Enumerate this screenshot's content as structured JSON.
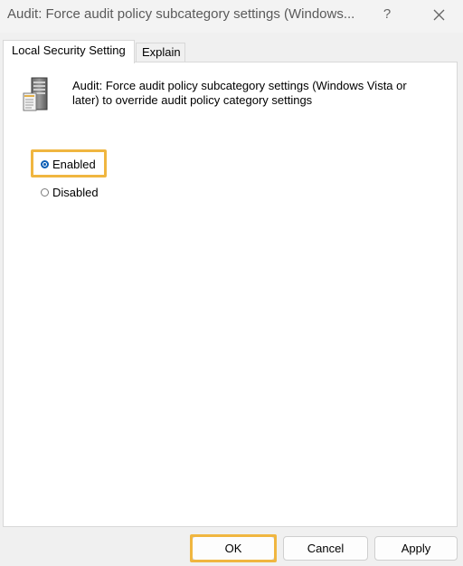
{
  "window": {
    "title": "Audit: Force audit policy subcategory settings (Windows...",
    "help_label": "?"
  },
  "tabs": [
    {
      "label": "Local Security Setting",
      "active": true
    },
    {
      "label": "Explain",
      "active": false
    }
  ],
  "policy": {
    "icon": "server-icon",
    "description": "Audit: Force audit policy subcategory settings (Windows Vista or later) to override audit policy category settings"
  },
  "options": [
    {
      "label": "Enabled",
      "checked": true
    },
    {
      "label": "Disabled",
      "checked": false
    }
  ],
  "buttons": {
    "ok": "OK",
    "cancel": "Cancel",
    "apply": "Apply"
  },
  "colors": {
    "highlight": "#f0b640",
    "radio_selected": "#0a5db5"
  }
}
